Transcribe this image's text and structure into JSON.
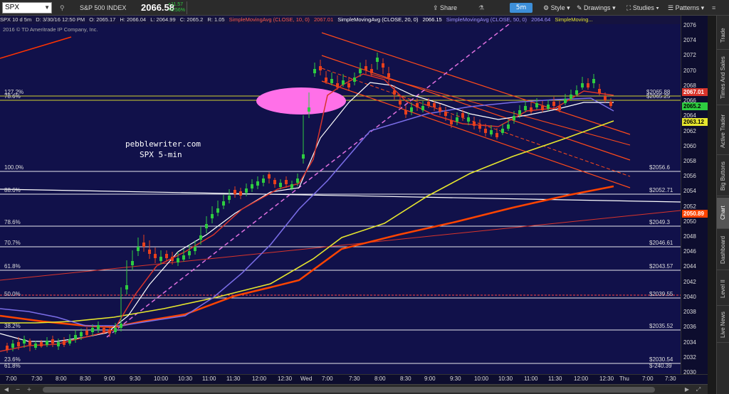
{
  "toolbar": {
    "symbol": "SPX",
    "index_name": "S&P 500 INDEX",
    "price": "2066.58",
    "change_up": "+11.57",
    "change_pct": "+0.56%",
    "share_label": "Share",
    "timeframe": "5m",
    "style_label": "Style",
    "drawings_label": "Drawings",
    "studies_label": "Studies",
    "patterns_label": "Patterns"
  },
  "infobar": {
    "symbol_period": "SPX 10 d 5m",
    "date": "D: 3/30/16 12:50 PM",
    "open": "O: 2065.17",
    "high": "H: 2066.04",
    "low": "L: 2064.99",
    "close": "C: 2065.2",
    "range": "R: 1.05",
    "sma10": "SimpleMovingAvg (CLOSE, 10, 0)",
    "sma10_val": "2067.01",
    "sma20": "SimpleMovingAvg (CLOSE, 20, 0)",
    "sma20_val": "2066.15",
    "sma50": "SimpleMovingAvg (CLOSE, 50, 0)",
    "sma50_val": "2064.64",
    "sma_more": "SimpleMoving..."
  },
  "chart": {
    "copyright": "2016 © TD Ameritrade IP Company, Inc.",
    "annotation_line1": "pebblewriter.com",
    "annotation_line2": "SPX 5-min",
    "colors": {
      "background": "#11114a",
      "sma10": "#d9342b",
      "sma20": "#ffffff",
      "sma50": "#7b6ee8",
      "sma100": "#e6e62e",
      "sma200": "#ff4400",
      "channel": "#ff4a1a",
      "trendline": "#e070e0",
      "ellipse": "#ff70e8"
    }
  },
  "fib_levels": [
    {
      "pct": "127.2%",
      "value": "2065.88"
    },
    {
      "pct": "78.6%",
      "value": "2065.25"
    },
    {
      "pct": "100.0%",
      "value": "2056.6"
    },
    {
      "pct": "88.6%",
      "value": "2052.71"
    },
    {
      "pct": "78.6%",
      "value": "2049.3"
    },
    {
      "pct": "70.7%",
      "value": "2046.61"
    },
    {
      "pct": "61.8%",
      "value": "2043.57"
    },
    {
      "pct": "50.0%",
      "value": "2039.55"
    },
    {
      "pct": "38.2%",
      "value": "2035.52"
    },
    {
      "pct": "23.6%",
      "value": "2030.54"
    },
    {
      "pct": "61.8%",
      "value": "-240.39"
    }
  ],
  "y_ticks": [
    "2076",
    "2074",
    "2072",
    "2070",
    "2068",
    "2066",
    "2064",
    "2062",
    "2060",
    "2058",
    "2056",
    "2054",
    "2052",
    "2050",
    "2048",
    "2046",
    "2044",
    "2042",
    "2040",
    "2038",
    "2036",
    "2034",
    "2032",
    "2030"
  ],
  "y_badges": {
    "sma10": "2067.01",
    "last": "2065.2",
    "sma100": "2063.12",
    "sma200": "2050.89"
  },
  "x_ticks": [
    "7:00",
    "7:30",
    "8:00",
    "8:30",
    "9:00",
    "9:30",
    "10:00",
    "10:30",
    "11:00",
    "11:30",
    "12:00",
    "12:30",
    "Wed",
    "7:00",
    "7:30",
    "8:00",
    "8:30",
    "9:00",
    "9:30",
    "10:00",
    "10:30",
    "11:00",
    "11:30",
    "12:00",
    "12:30",
    "Thu",
    "7:00",
    "7:30"
  ],
  "sidebar": {
    "tabs": [
      "Trade",
      "Times And Sales",
      "Active Trader",
      "Big Buttons",
      "Chart",
      "Dashboard",
      "Level II",
      "Live News"
    ]
  },
  "chart_data": {
    "type": "candlestick",
    "ylim": [
      2030,
      2077
    ],
    "series": [
      {
        "name": "SimpleMovingAvg (CLOSE, 10, 0)"
      },
      {
        "name": "SimpleMovingAvg (CLOSE, 20, 0)"
      },
      {
        "name": "SimpleMovingAvg (CLOSE, 50, 0)"
      }
    ]
  }
}
